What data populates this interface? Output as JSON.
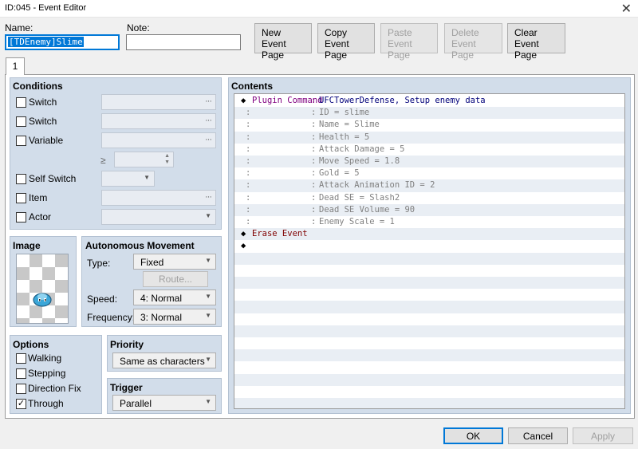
{
  "window": {
    "title": "ID:045 - Event Editor"
  },
  "name_field": {
    "label": "Name:",
    "value": "[TDEnemy]Slime"
  },
  "note_field": {
    "label": "Note:",
    "value": ""
  },
  "toolbar": {
    "new_page": [
      "New",
      "Event Page"
    ],
    "copy_page": [
      "Copy",
      "Event Page"
    ],
    "paste_page": [
      "Paste",
      "Event Page"
    ],
    "delete_page": [
      "Delete",
      "Event Page"
    ],
    "clear_page": [
      "Clear",
      "Event Page"
    ]
  },
  "tabs": [
    {
      "label": "1"
    }
  ],
  "conditions": {
    "title": "Conditions",
    "switch1": {
      "label": "Switch",
      "checked": false
    },
    "switch2": {
      "label": "Switch",
      "checked": false
    },
    "variable": {
      "label": "Variable",
      "checked": false,
      "operator": "≥"
    },
    "self_switch": {
      "label": "Self Switch",
      "checked": false
    },
    "item": {
      "label": "Item",
      "checked": false
    },
    "actor": {
      "label": "Actor",
      "checked": false
    }
  },
  "image": {
    "title": "Image",
    "character": "slime-sprite"
  },
  "autonomous": {
    "title": "Autonomous Movement",
    "type_label": "Type:",
    "type_value": "Fixed",
    "route_label": "Route...",
    "speed_label": "Speed:",
    "speed_value": "4: Normal",
    "frequency_label": "Frequency:",
    "frequency_value": "3: Normal"
  },
  "options": {
    "title": "Options",
    "walking": {
      "label": "Walking",
      "checked": false
    },
    "stepping": {
      "label": "Stepping",
      "checked": false
    },
    "direction_fix": {
      "label": "Direction Fix",
      "checked": false
    },
    "through": {
      "label": "Through",
      "checked": true
    }
  },
  "priority": {
    "title": "Priority",
    "value": "Same as characters"
  },
  "trigger": {
    "title": "Trigger",
    "value": "Parallel"
  },
  "contents": {
    "title": "Contents",
    "commands": [
      {
        "diamond": "◆",
        "name": "Plugin Command",
        "colon": ":",
        "arg": "UFCTowerDefense, Setup enemy data",
        "style": "plugin"
      },
      {
        "diamond": "",
        "name": ":",
        "colon": ":",
        "arg": "ID = slime",
        "style": "cont"
      },
      {
        "diamond": "",
        "name": ":",
        "colon": ":",
        "arg": "Name = Slime",
        "style": "cont"
      },
      {
        "diamond": "",
        "name": ":",
        "colon": ":",
        "arg": "Health = 5",
        "style": "cont"
      },
      {
        "diamond": "",
        "name": ":",
        "colon": ":",
        "arg": "Attack Damage = 5",
        "style": "cont"
      },
      {
        "diamond": "",
        "name": ":",
        "colon": ":",
        "arg": "Move Speed = 1.8",
        "style": "cont"
      },
      {
        "diamond": "",
        "name": ":",
        "colon": ":",
        "arg": "Gold = 5",
        "style": "cont"
      },
      {
        "diamond": "",
        "name": ":",
        "colon": ":",
        "arg": "Attack Animation ID = 2",
        "style": "cont"
      },
      {
        "diamond": "",
        "name": ":",
        "colon": ":",
        "arg": "Dead SE = Slash2",
        "style": "cont"
      },
      {
        "diamond": "",
        "name": ":",
        "colon": ":",
        "arg": "Dead SE Volume = 90",
        "style": "cont"
      },
      {
        "diamond": "",
        "name": ":",
        "colon": ":",
        "arg": "Enemy Scale = 1",
        "style": "cont"
      },
      {
        "diamond": "◆",
        "name": "Erase Event",
        "colon": "",
        "arg": "",
        "style": "erase"
      },
      {
        "diamond": "◆",
        "name": "",
        "colon": "",
        "arg": "",
        "style": "empty"
      }
    ]
  },
  "footer": {
    "ok": "OK",
    "cancel": "Cancel",
    "apply": "Apply"
  },
  "colors": {
    "accent": "#0078d7",
    "panel": "#d2ddea",
    "plugin_text": "#800080",
    "erase_text": "#800000"
  }
}
